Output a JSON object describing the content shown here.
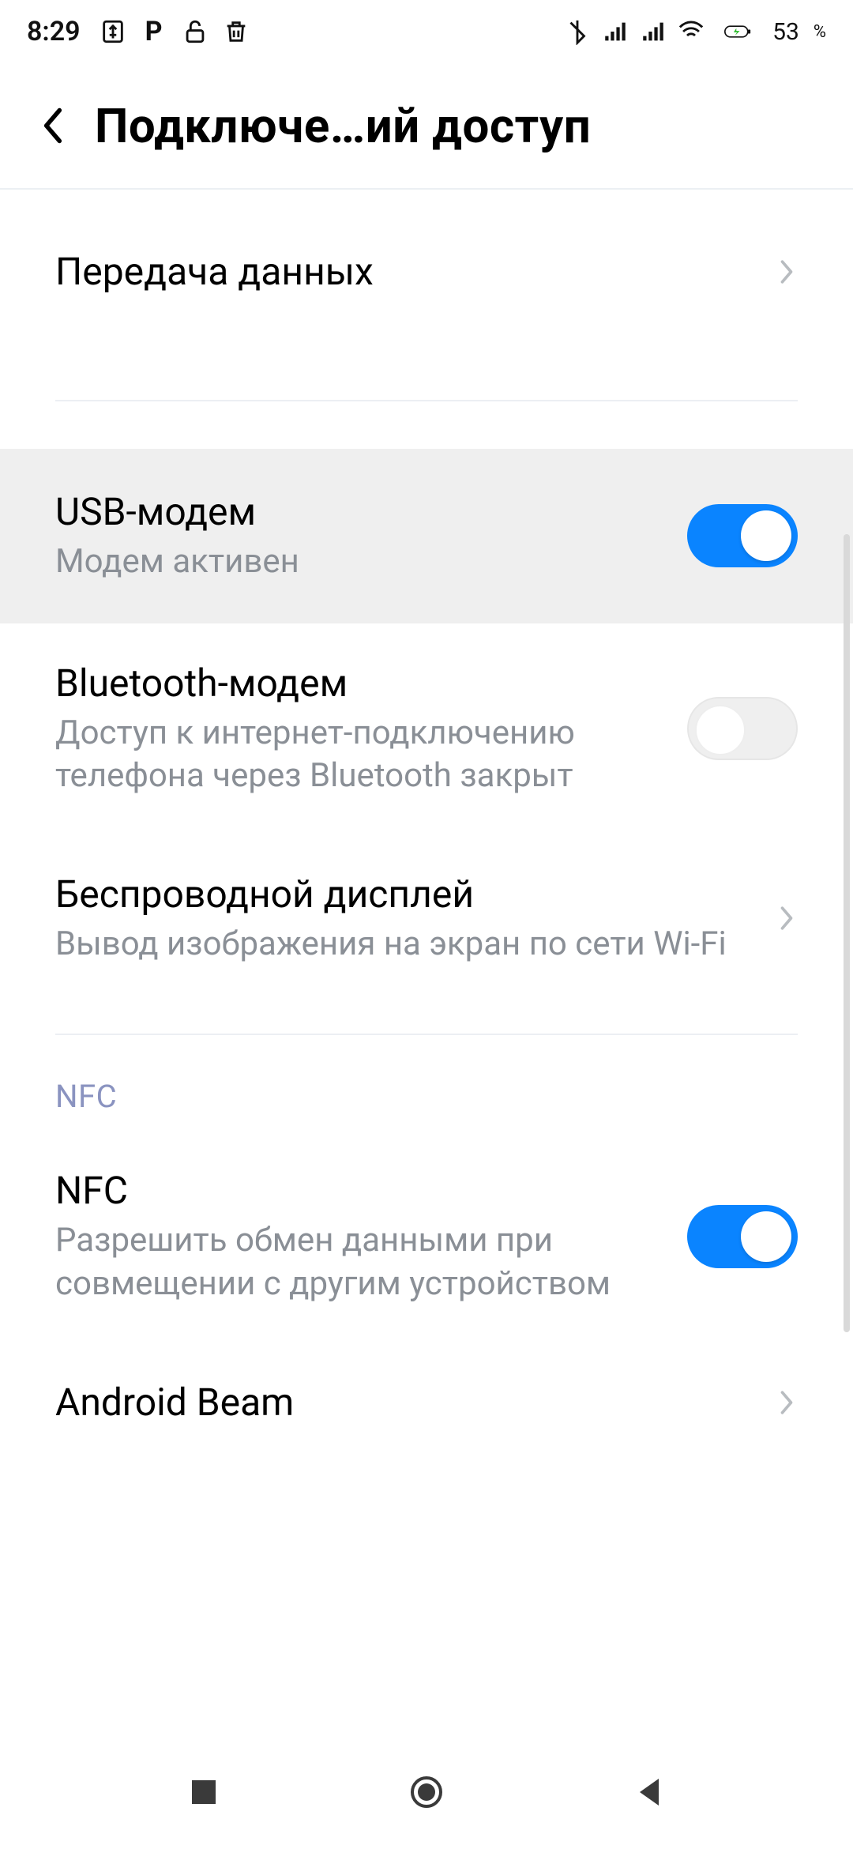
{
  "statusbar": {
    "time": "8:29",
    "battery_pct": "53",
    "battery_sym": "%",
    "icons_left": [
      "usb-icon",
      "p-icon",
      "unlock-icon",
      "trash-icon"
    ],
    "icons_right": [
      "bluetooth-icon",
      "signal-icon",
      "signal-icon",
      "wifi-icon",
      "battery-icon"
    ]
  },
  "header": {
    "title": "Подключе…ий доступ"
  },
  "items": {
    "data_transfer": {
      "label": "Передача данных"
    },
    "usb_modem": {
      "label": "USB-модем",
      "sub": "Модем активен",
      "on": true
    },
    "bt_modem": {
      "label": "Bluetooth-модем",
      "sub": "Доступ к интернет-подключению телефона через Bluetooth закрыт",
      "on": false
    },
    "wireless_display": {
      "label": "Беспроводной дисплей",
      "sub": "Вывод изображения на экран по сети Wi-Fi"
    },
    "nfc_heading": "NFC",
    "nfc": {
      "label": "NFC",
      "sub": "Разрешить обмен данными при совмещении с другим устройством",
      "on": true
    },
    "android_beam": {
      "label": "Android Beam"
    }
  }
}
